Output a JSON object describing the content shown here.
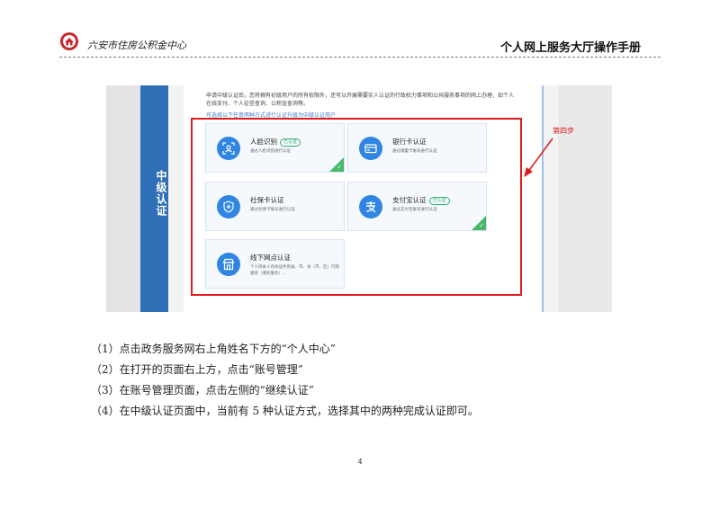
{
  "header": {
    "org_name": "六安市住房公积金中心",
    "doc_title": "个人网上服务大厅操作手册",
    "brand_color": "#c8282d"
  },
  "screenshot": {
    "side_tab": "中级认证",
    "intro_text": "申请中级认证后，您将拥有初级用户的所有权限外，还可以开展需要实人认证的行政权力事项和公共服务事项的网上办理，如个人在线支付、个人征信查询、公积金查询等。",
    "hint_text": "可选择以下任意两种方式进行认证升级为中级认证用户",
    "cards": [
      {
        "title": "人脸识别",
        "badge": "已认证",
        "desc": "通过人脸识别进行认证",
        "icon": "face-scan-icon",
        "completed": true
      },
      {
        "title": "银行卡认证",
        "badge": "",
        "desc": "通过储蓄卡账号进行认证",
        "icon": "bank-card-icon",
        "completed": false
      },
      {
        "title": "社保卡认证",
        "badge": "",
        "desc": "通过社保卡账号进行认证",
        "icon": "shield-icon",
        "completed": false
      },
      {
        "title": "支付宝认证",
        "badge": "已认证",
        "desc": "通过支付宝账号进行认证",
        "icon": "alipay-icon",
        "completed": true
      },
      {
        "title": "线下网点认证",
        "badge": "",
        "desc": "个人持本人有效证件到省、市、县（市、区）行政服务（便民服务）...",
        "icon": "store-icon",
        "completed": false
      }
    ],
    "callout": "第四步"
  },
  "steps": [
    "（1）点击政务服务网右上角姓名下方的“个人中心”",
    "（2）在打开的页面右上方，点击“账号管理”",
    "（3）在账号管理页面，点击左侧的“继续认证”",
    "（4）在中级认证页面中，当前有 5 种认证方式，选择其中的两种完成认证即可。"
  ],
  "page_number": "4",
  "colors": {
    "accent_blue": "#2e6fb6",
    "icon_blue": "#2f86e2",
    "highlight_red": "#e01b1b",
    "verified_green": "#39b071"
  }
}
